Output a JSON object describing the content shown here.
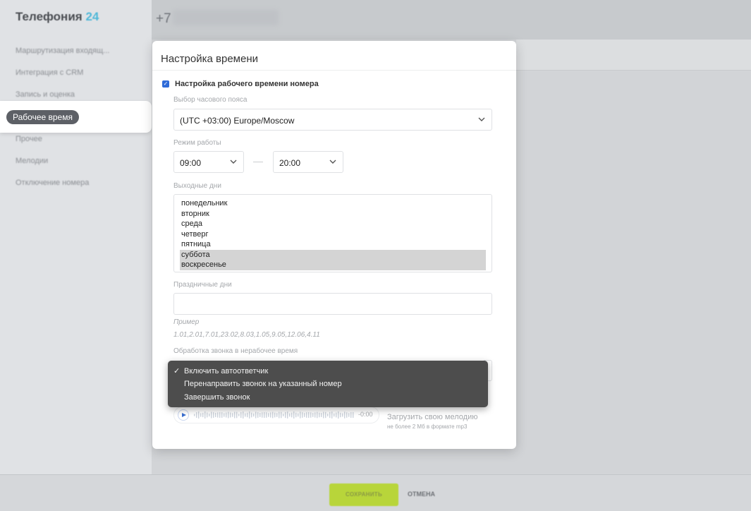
{
  "app": {
    "logo_text": "Телефония",
    "logo_num": "24",
    "phone_prefix": "+7"
  },
  "sidebar": {
    "items": [
      {
        "label": "Маршрутизация входящ..."
      },
      {
        "label": "Интеграция с CRM"
      },
      {
        "label": "Запись и оценка"
      },
      {
        "label": "Рабочее время"
      },
      {
        "label": "Прочее"
      },
      {
        "label": "Мелодии"
      },
      {
        "label": "Отключение номера"
      }
    ]
  },
  "modal": {
    "title": "Настройка времени",
    "checkbox_label": "Настройка рабочего времени номера",
    "timezone_label": "Выбор часового пояса",
    "timezone_value": "(UTC +03:00) Europe/Moscow",
    "work_mode_label": "Режим работы",
    "time_from": "09:00",
    "time_to": "20:00",
    "weekends_label": "Выходные дни",
    "weekdays": [
      {
        "label": "понедельник",
        "selected": false
      },
      {
        "label": "вторник",
        "selected": false
      },
      {
        "label": "среда",
        "selected": false
      },
      {
        "label": "четверг",
        "selected": false
      },
      {
        "label": "пятница",
        "selected": false
      },
      {
        "label": "суббота",
        "selected": true
      },
      {
        "label": "воскресенье",
        "selected": true
      }
    ],
    "holidays_label": "Праздничные дни",
    "holidays_value": "",
    "hint_title": "Пример",
    "hint_value": "1.01,2.01,7.01,23.02,8.03,1.05,9.05,12.06,4.11",
    "offhours_label": "Обработка звонка в нерабочее время",
    "player_time": "-0:00",
    "upload_label": "Загрузить свою мелодию",
    "upload_hint": "не более 2 Мб в формате mp3"
  },
  "offhours_menu": {
    "options": [
      {
        "label": "Включить автоответчик",
        "checked": true,
        "check": "✓"
      },
      {
        "label": "Перенаправить звонок на указанный номер",
        "checked": false,
        "check": ""
      },
      {
        "label": "Завершить звонок",
        "checked": false,
        "check": ""
      }
    ]
  },
  "footer": {
    "save_label": "СОХРАНИТЬ",
    "cancel_label": "ОТМЕНА"
  },
  "colors": {
    "accent_blue": "#2f6bd8",
    "save_green": "#b8d53a",
    "logo_num": "#4fb8d8"
  }
}
